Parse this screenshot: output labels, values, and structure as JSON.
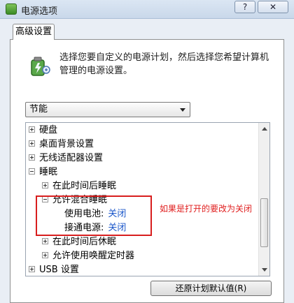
{
  "window": {
    "title": "电源选项",
    "help_label": "?",
    "close_label": "✕",
    "icon": "power-plan-icon"
  },
  "tab": {
    "label": "高级设置"
  },
  "description": "选择您要自定义的电源计划，然后选择您希望计算机管理的电源设置。",
  "plan_select": {
    "value": "节能"
  },
  "tree": {
    "items": [
      {
        "label": "硬盘",
        "expander": "+"
      },
      {
        "label": "桌面背景设置",
        "expander": "+"
      },
      {
        "label": "无线适配器设置",
        "expander": "+"
      },
      {
        "label": "睡眠",
        "expander": "−"
      },
      {
        "label": "在此时间后睡眠",
        "expander": "+"
      },
      {
        "label": "允许混合睡眠",
        "expander": "−"
      },
      {
        "label": "使用电池:",
        "value": "关闭"
      },
      {
        "label": "接通电源:",
        "value": "关闭"
      },
      {
        "label": "在此时间后休眠",
        "expander": "+"
      },
      {
        "label": "允许使用唤醒定时器",
        "expander": "+"
      },
      {
        "label": "USB 设置",
        "expander": "+"
      }
    ]
  },
  "annotation": {
    "text": "如果是打开的要改为关闭",
    "color": "#e01e1e"
  },
  "buttons": {
    "restore": "还原计划默认值(R)"
  },
  "colors": {
    "link": "#1a56c9",
    "highlight": "#d81e1e"
  }
}
